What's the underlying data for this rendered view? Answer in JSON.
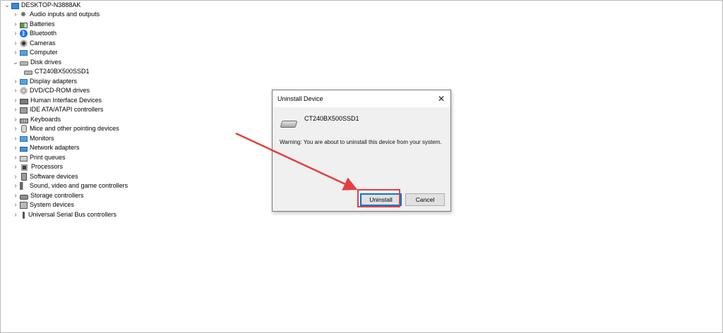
{
  "tree": {
    "root": {
      "label": "DESKTOP-N3888AK",
      "icon": "computer-icon"
    },
    "items": [
      {
        "label": "Audio inputs and outputs",
        "icon": "speaker-icon",
        "expanded": false
      },
      {
        "label": "Batteries",
        "icon": "battery-icon",
        "expanded": false
      },
      {
        "label": "Bluetooth",
        "icon": "bluetooth-icon",
        "expanded": false
      },
      {
        "label": "Cameras",
        "icon": "camera-icon",
        "expanded": false
      },
      {
        "label": "Computer",
        "icon": "monitor-icon",
        "expanded": false
      },
      {
        "label": "Disk drives",
        "icon": "disk-drive-icon",
        "expanded": true
      },
      {
        "label": "CT240BX500SSD1",
        "icon": "disk-drive-icon",
        "child": true
      },
      {
        "label": "Display adapters",
        "icon": "display-adapter-icon",
        "expanded": false
      },
      {
        "label": "DVD/CD-ROM drives",
        "icon": "dvd-icon",
        "expanded": false
      },
      {
        "label": "Human Interface Devices",
        "icon": "hid-icon",
        "expanded": false
      },
      {
        "label": "IDE ATA/ATAPI controllers",
        "icon": "ide-icon",
        "expanded": false
      },
      {
        "label": "Keyboards",
        "icon": "keyboard-icon",
        "expanded": false
      },
      {
        "label": "Mice and other pointing devices",
        "icon": "mouse-icon",
        "expanded": false
      },
      {
        "label": "Monitors",
        "icon": "monitor-icon",
        "expanded": false
      },
      {
        "label": "Network adapters",
        "icon": "network-icon",
        "expanded": false
      },
      {
        "label": "Print queues",
        "icon": "printer-icon",
        "expanded": false
      },
      {
        "label": "Processors",
        "icon": "processor-icon",
        "expanded": false
      },
      {
        "label": "Software devices",
        "icon": "software-device-icon",
        "expanded": false
      },
      {
        "label": "Sound, video and game controllers",
        "icon": "sound-icon",
        "expanded": false
      },
      {
        "label": "Storage controllers",
        "icon": "storage-icon",
        "expanded": false
      },
      {
        "label": "System devices",
        "icon": "system-device-icon",
        "expanded": false
      },
      {
        "label": "Universal Serial Bus controllers",
        "icon": "usb-icon",
        "expanded": false
      }
    ]
  },
  "dialog": {
    "title": "Uninstall Device",
    "device_name": "CT240BX500SSD1",
    "warning": "Warning: You are about to uninstall this device from your system.",
    "uninstall_label": "Uninstall",
    "cancel_label": "Cancel",
    "close_glyph": "✕"
  },
  "colors": {
    "annotation_red": "#e43f40",
    "focus_blue": "#0078d7"
  }
}
